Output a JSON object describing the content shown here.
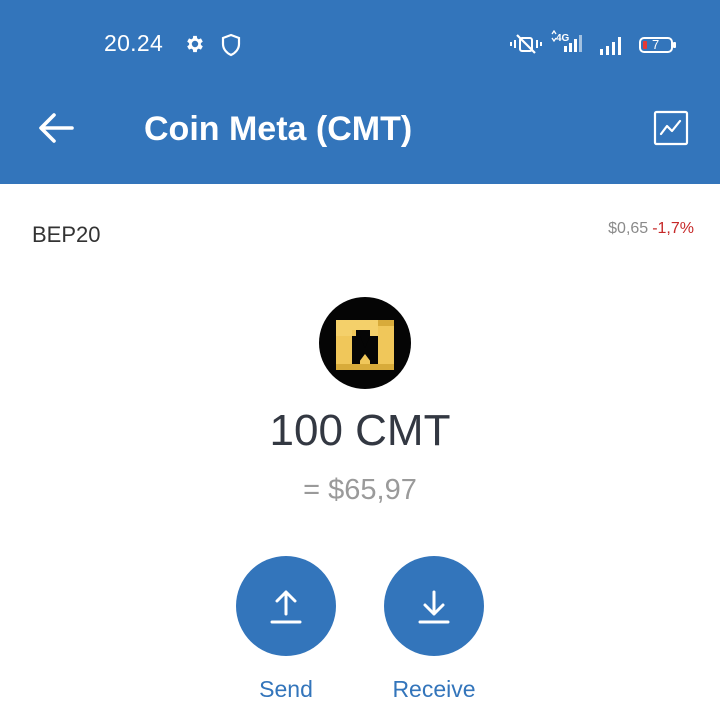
{
  "status_bar": {
    "time": "20.24",
    "network_type": "4G",
    "battery": "7"
  },
  "header": {
    "title": "Coin Meta (CMT)",
    "icons": {
      "back": "arrow-left-icon",
      "chart": "chart-icon"
    }
  },
  "token": {
    "network": "BEP20",
    "price": "$0,65",
    "change": "-1,7%",
    "balance": "100 CMT",
    "fiat_value": "= $65,97"
  },
  "actions": {
    "send_label": "Send",
    "receive_label": "Receive"
  },
  "colors": {
    "brand": "#3375bb",
    "negative": "#c62828",
    "logo_gold": "#f0c75a"
  }
}
